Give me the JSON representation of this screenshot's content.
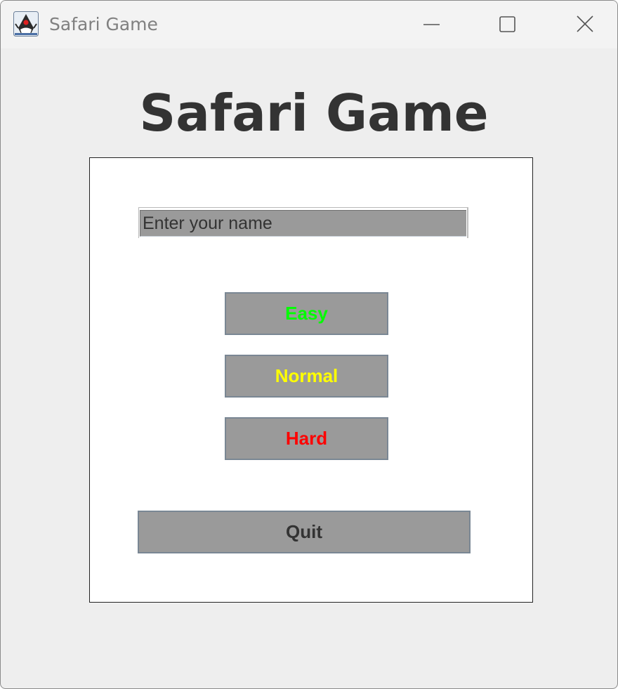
{
  "window": {
    "title": "Safari Game",
    "controls": {
      "minimize": "minimize-icon",
      "maximize": "maximize-icon",
      "close": "close-icon"
    },
    "app_icon": "java-duke-icon"
  },
  "main": {
    "heading": "Safari Game",
    "name_input": {
      "value": "Enter your name"
    },
    "difficulty_buttons": [
      {
        "label": "Easy",
        "color": "#00ff00"
      },
      {
        "label": "Normal",
        "color": "#ffff00"
      },
      {
        "label": "Hard",
        "color": "#ff0000"
      }
    ],
    "quit_button": {
      "label": "Quit",
      "color": "#333333"
    }
  },
  "colors": {
    "window_background": "#eeeeee",
    "panel_background": "#ffffff",
    "button_background": "#9a9a9a",
    "title_text": "#333333"
  }
}
